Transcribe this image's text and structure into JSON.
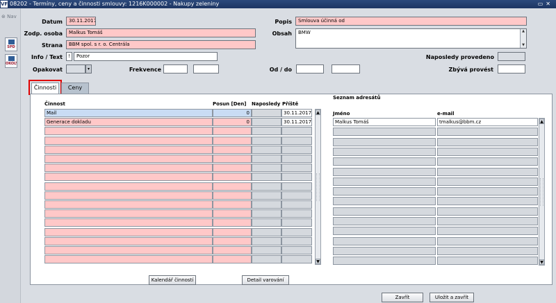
{
  "window": {
    "title": "08202 - Termíny, ceny a činnosti smlouvy: 1216K000002 - Nakupy zeleniny",
    "app_icon": "VF"
  },
  "sidebar": {
    "nav_label": "Nav",
    "buttons": [
      "SPD",
      "OKOLY"
    ]
  },
  "form": {
    "datum_label": "Datum",
    "datum_value": "30.11.2017",
    "zodp_label": "Zodp. osoba",
    "zodp_value": "Malkus Tomáš",
    "strana_label": "Strana",
    "strana_value": "BBM spol. s r. o. Centrála",
    "info_label": "Info / Text",
    "info_flag": "!",
    "info_value": "Pozor",
    "opakovat_label": "Opakovat",
    "opakovat_value": "",
    "frekvence_label": "Frekvence",
    "frekvence_value1": "",
    "frekvence_value2": "",
    "popis_label": "Popis",
    "popis_value": "Smlouva účinná od",
    "obsah_label": "Obsah",
    "obsah_value": "BMW",
    "od_do_label": "Od / do",
    "od_value": "",
    "do_value": "",
    "naposledy_label": "Naposledy provedeno",
    "naposledy_value": "",
    "zbyva_label": "Zbývá provést",
    "zbyva_value": ""
  },
  "tabs": [
    {
      "label": "Činnosti",
      "active": true
    },
    {
      "label": "Ceny",
      "active": false
    }
  ],
  "activities": {
    "headers": {
      "cinnost": "Činnost",
      "posun": "Posun [Den]",
      "naposledy": "Naposledy",
      "priste": "Příště"
    },
    "rows": [
      {
        "cinnost": "Mail",
        "posun": "0",
        "naposledy": "",
        "priste": "30.11.2017",
        "selected": true
      },
      {
        "cinnost": "Generace dokladu",
        "posun": "0",
        "naposledy": "",
        "priste": "30.11.2017",
        "selected": false
      },
      {
        "cinnost": "",
        "posun": "",
        "naposledy": "",
        "priste": "",
        "selected": false
      },
      {
        "cinnost": "",
        "posun": "",
        "naposledy": "",
        "priste": "",
        "selected": false
      },
      {
        "cinnost": "",
        "posun": "",
        "naposledy": "",
        "priste": "",
        "selected": false
      },
      {
        "cinnost": "",
        "posun": "",
        "naposledy": "",
        "priste": "",
        "selected": false
      },
      {
        "cinnost": "",
        "posun": "",
        "naposledy": "",
        "priste": "",
        "selected": false
      },
      {
        "cinnost": "",
        "posun": "",
        "naposledy": "",
        "priste": "",
        "selected": false
      },
      {
        "cinnost": "",
        "posun": "",
        "naposledy": "",
        "priste": "",
        "selected": false
      },
      {
        "cinnost": "",
        "posun": "",
        "naposledy": "",
        "priste": "",
        "selected": false
      },
      {
        "cinnost": "",
        "posun": "",
        "naposledy": "",
        "priste": "",
        "selected": false
      },
      {
        "cinnost": "",
        "posun": "",
        "naposledy": "",
        "priste": "",
        "selected": false
      },
      {
        "cinnost": "",
        "posun": "",
        "naposledy": "",
        "priste": "",
        "selected": false
      },
      {
        "cinnost": "",
        "posun": "",
        "naposledy": "",
        "priste": "",
        "selected": false
      },
      {
        "cinnost": "",
        "posun": "",
        "naposledy": "",
        "priste": "",
        "selected": false
      },
      {
        "cinnost": "",
        "posun": "",
        "naposledy": "",
        "priste": "",
        "selected": false
      },
      {
        "cinnost": "",
        "posun": "",
        "naposledy": "",
        "priste": "",
        "selected": false
      }
    ]
  },
  "recipients": {
    "section_title": "Seznam adresátů",
    "headers": {
      "jmeno": "Jméno",
      "email": "e-mail"
    },
    "rows": [
      {
        "jmeno": "Malkus Tomáš",
        "email": "tmalkus@bbm.cz"
      },
      {
        "jmeno": "",
        "email": ""
      },
      {
        "jmeno": "",
        "email": ""
      },
      {
        "jmeno": "",
        "email": ""
      },
      {
        "jmeno": "",
        "email": ""
      },
      {
        "jmeno": "",
        "email": ""
      },
      {
        "jmeno": "",
        "email": ""
      },
      {
        "jmeno": "",
        "email": ""
      },
      {
        "jmeno": "",
        "email": ""
      },
      {
        "jmeno": "",
        "email": ""
      },
      {
        "jmeno": "",
        "email": ""
      },
      {
        "jmeno": "",
        "email": ""
      },
      {
        "jmeno": "",
        "email": ""
      },
      {
        "jmeno": "",
        "email": ""
      },
      {
        "jmeno": "",
        "email": ""
      }
    ]
  },
  "buttons": {
    "kalendar": "Kalendář činností",
    "detail": "Detail varování",
    "zavrit": "Zavřít",
    "ulozit": "Uložit a zavřít"
  }
}
